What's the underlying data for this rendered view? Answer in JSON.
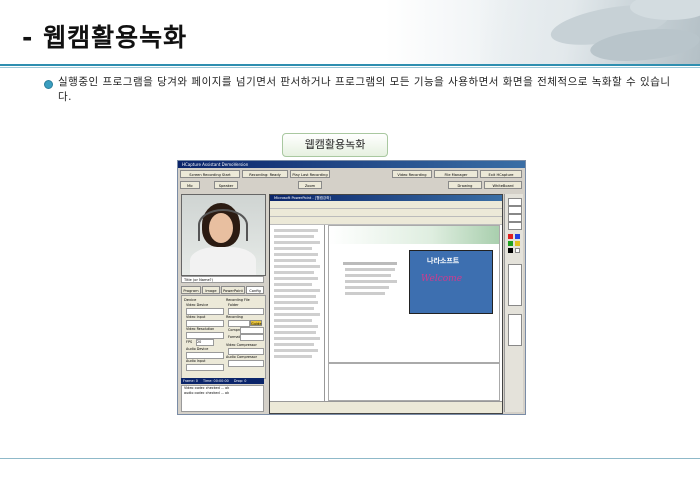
{
  "header": {
    "title": "- 웹캠활용녹화"
  },
  "main": {
    "description": "실행중인 프로그램을 당겨와 페이지를 넘기면서 판서하거나 프로그램의 모든 기능을 사용하면서 화면을 전체적으로 녹화할 수 있습니다.",
    "section_label": "웹캠활용녹화"
  },
  "screenshot": {
    "window_title": "HCapture Assistant DemoVersion",
    "buttons": {
      "screen_recording": "Screen Recording Start",
      "recording": "Recording: Ready",
      "play_last": "Play Last Recording",
      "video_recording": "Video Recording",
      "file_manager": "File Manager",
      "exit": "Exit HCapture",
      "mic": "Mic",
      "speaker": "Speaker",
      "zoom": "Zoom",
      "drawing": "Drawing",
      "whiteboard": "WhiteBoard"
    },
    "tabs": [
      "Program",
      "Image",
      "PowerPoint",
      "Config"
    ],
    "webcam_caption": "Title (or Name?)",
    "config": {
      "device": "Device",
      "video_device": "Video Device",
      "video_input": "Video Input",
      "video_resolution": "Video Resolution",
      "fps": "FPS",
      "fps_value": "20",
      "audio_device": "Audio Device",
      "audio_input": "Audio Input",
      "recording_file": "Recording File",
      "folder": "Folder",
      "recording": "Recording",
      "compress": "Compress",
      "format": "Format",
      "video_compressor": "Video Compressor",
      "audio_compressor": "Audio Compressor",
      "guide": "Guide"
    },
    "status": {
      "frame": "Frame: 0",
      "time": "Time: 00:00:00",
      "drop": "Drop: 0"
    },
    "log": [
      "Video codec checked ... ok",
      "audio codec checked ... ok"
    ],
    "powerpoint": {
      "window_title": "Microsoft PowerPoint - [웹캠강좌]",
      "slide_brand": "나라소프트",
      "slide_welcome": "Welcome"
    }
  }
}
